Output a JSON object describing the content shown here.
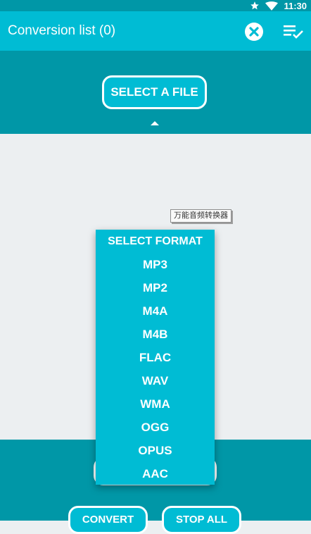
{
  "status_bar": {
    "time": "11:30",
    "icons": [
      "star-icon",
      "wifi-icon"
    ]
  },
  "app_bar": {
    "title": "Conversion list (0)",
    "actions": [
      "clear-list-icon",
      "queue-check-icon"
    ]
  },
  "select_panel": {
    "select_file_label": "SELECT A FILE"
  },
  "tooltip": {
    "text": "万能音频转换器"
  },
  "format_menu": {
    "title": "SELECT FORMAT",
    "options": [
      "MP3",
      "MP2",
      "M4A",
      "M4B",
      "FLAC",
      "WAV",
      "WMA",
      "OGG",
      "OPUS",
      "AAC"
    ]
  },
  "bottom_panel": {
    "convert_label": "CONVERT",
    "stop_all_label": "STOP ALL"
  },
  "colors": {
    "primary": "#00bcd4",
    "primary_dark": "#0097a7",
    "background": "#eceff1",
    "on_primary": "#ffffff"
  }
}
